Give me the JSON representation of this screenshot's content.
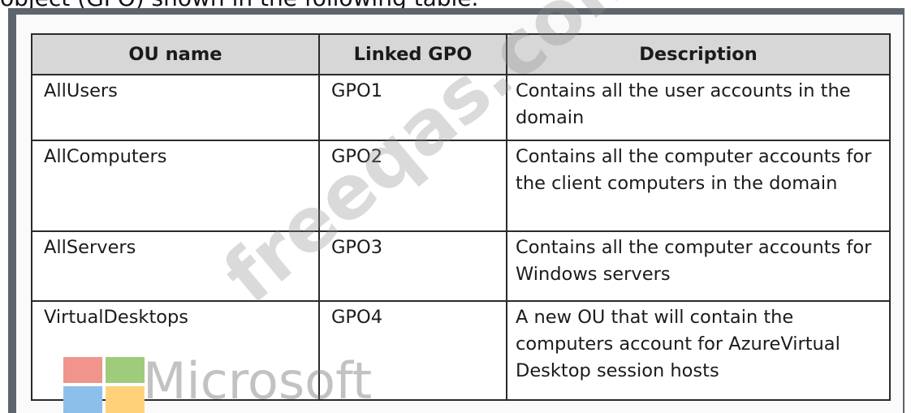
{
  "top_text": "object (GPO) shown in the following table.",
  "table": {
    "headers": [
      "OU name",
      "Linked GPO",
      "Description"
    ],
    "rows": [
      [
        "AllUsers",
        "GPO1",
        "Contains all the user accounts in the domain"
      ],
      [
        "AllComputers",
        "GPO2",
        "Contains all the computer accounts for the client computers in the domain"
      ],
      [
        "AllServers",
        "GPO3",
        "Contains all the computer accounts for Windows servers"
      ],
      [
        "VirtualDesktops",
        "GPO4",
        "A new OU that will contain the computers account for AzureVirtual Desktop session hosts"
      ]
    ]
  },
  "watermark": "freeqas.com",
  "logo_text": "Microsoft",
  "colors": {
    "logo_red": "#f1948b",
    "logo_green": "#9fcb7c",
    "logo_blue": "#8cc0ea",
    "logo_yellow": "#ffd27a"
  }
}
